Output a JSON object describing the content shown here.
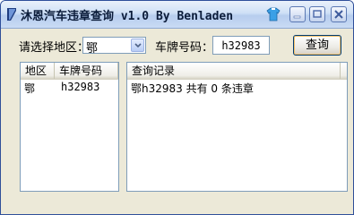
{
  "window": {
    "title": "沐恩汽车违章查询 v1.0 By Benladen",
    "controls": [
      "minimize",
      "maximize",
      "close"
    ]
  },
  "form": {
    "region_label": "请选择地区：",
    "region_value": "鄂",
    "plate_label": "车牌号码：",
    "plate_value": "h32983",
    "query_button": "查询"
  },
  "left_list": {
    "columns": [
      "地区",
      "车牌号码"
    ],
    "rows": [
      {
        "region": "鄂",
        "plate": "h32983"
      }
    ]
  },
  "right_list": {
    "columns": [
      "查询记录"
    ],
    "rows": [
      {
        "text": "鄂h32983 共有 0 条违章"
      }
    ]
  },
  "colors": {
    "titlebar": "#cfe0f6",
    "window_bg": "#ece9d8",
    "border": "#7f9db9"
  }
}
